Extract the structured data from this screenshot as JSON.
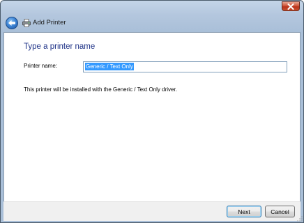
{
  "window": {
    "nav_title": "Add Printer"
  },
  "icons": {
    "back": "back-arrow-icon",
    "printer": "printer-icon",
    "close": "close-icon"
  },
  "page": {
    "heading": "Type a printer name",
    "printer_name_label": "Printer name:",
    "printer_name_value": "Generic / Text Only",
    "info": "This printer will be installed with the Generic / Text Only driver."
  },
  "buttons": {
    "next": "Next",
    "cancel": "Cancel"
  },
  "colors": {
    "heading": "#1e3287",
    "selection": "#3399ff",
    "close_button": "#c9502f"
  }
}
